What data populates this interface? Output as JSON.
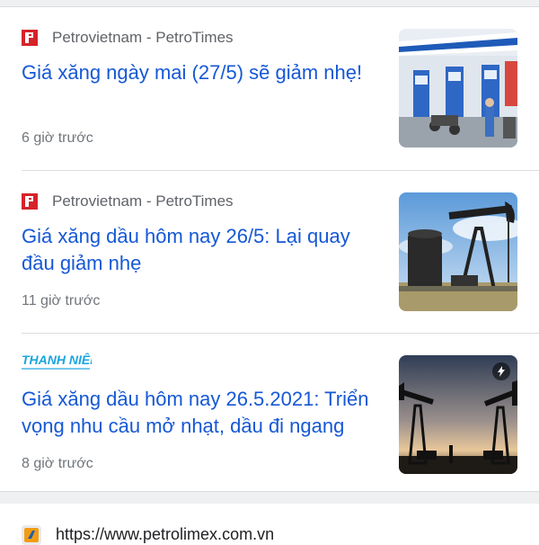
{
  "articles": [
    {
      "source": "Petrovietnam - PetroTimes",
      "source_icon": "petrovietnam-logo",
      "headline": "Giá xăng ngày mai (27/5) sẽ giảm nhẹ!",
      "time": "6 giờ trước",
      "thumbnail": "gas-station"
    },
    {
      "source": "Petrovietnam - PetroTimes",
      "source_icon": "petrovietnam-logo",
      "headline_lines": [
        "Giá xăng dầu hôm nay 26/5: Lại quay",
        "đầu giảm nhẹ"
      ],
      "time": "11 giờ trước",
      "thumbnail": "oil-pumpjack"
    },
    {
      "source": "THANH NIÊN",
      "source_icon": "thanhnien-logo",
      "headline_lines": [
        "Giá xăng dầu hôm nay 26.5.2021: Triển",
        "vọng nhu cầu mở nhạt, dầu đi ngang"
      ],
      "time": "8 giờ trước",
      "thumbnail": "oil-pumpjacks-sunset",
      "badge_icon": "lightning-icon"
    }
  ],
  "next_result": {
    "url": "https://www.petrolimex.com.vn",
    "icon": "petrolimex-logo"
  },
  "colors": {
    "headline": "#1558d6",
    "meta": "#70757a",
    "brand_red": "#d5232a",
    "thanhnien_blue": "#1aa5e0"
  }
}
